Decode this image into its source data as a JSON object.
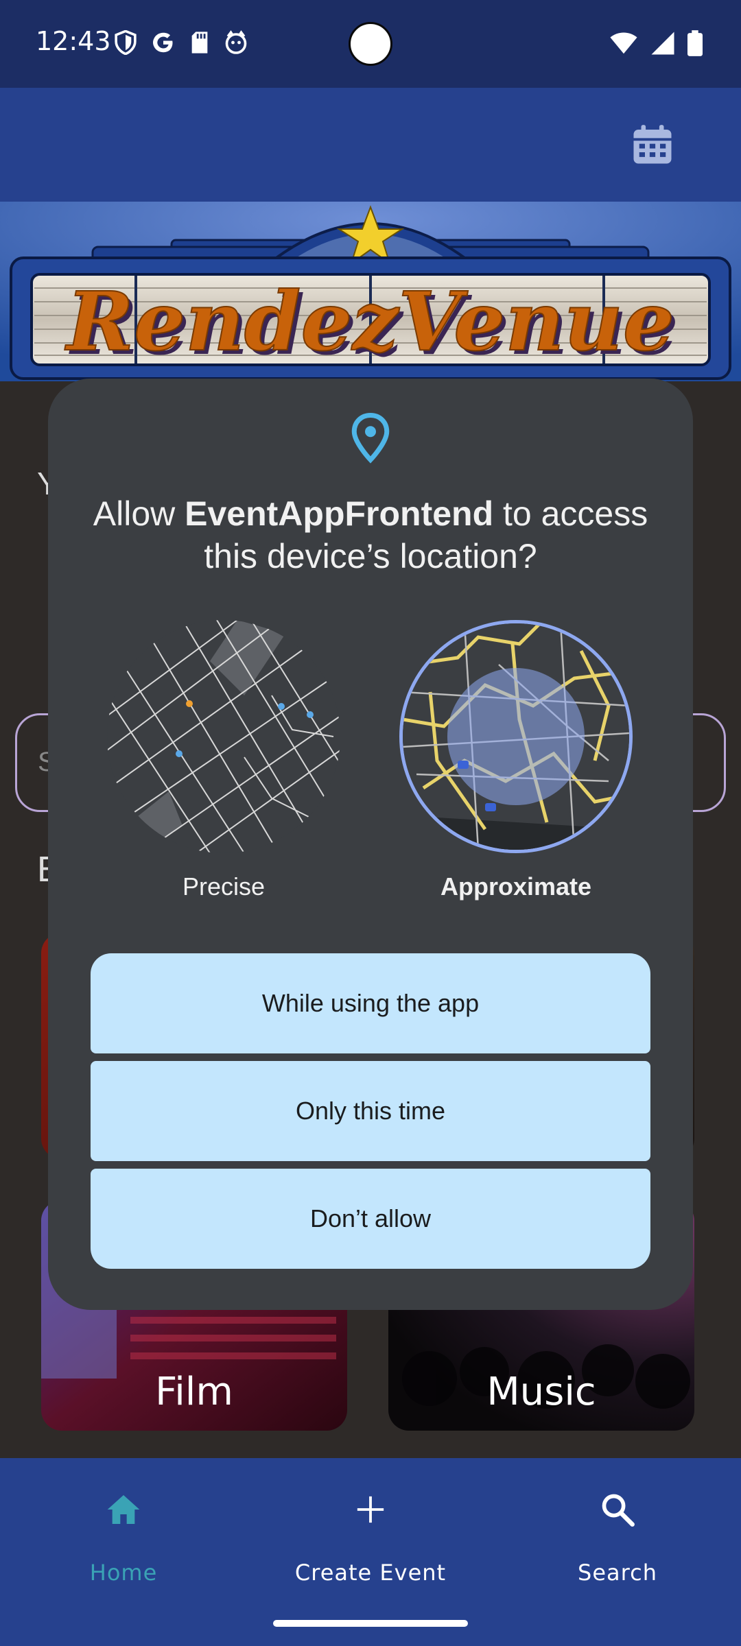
{
  "status_bar": {
    "time": "12:43"
  },
  "app": {
    "logo_text": "RendezVenue"
  },
  "background": {
    "greeting_partial": "Y",
    "search_placeholder_partial": "S",
    "section_partial": "E",
    "cards": [
      {
        "label": "Film"
      },
      {
        "label": "Music"
      }
    ]
  },
  "dialog": {
    "title_prefix": "Allow ",
    "app_name": "EventAppFrontend",
    "title_suffix": " to access this device’s location?",
    "options": [
      {
        "label": "Precise",
        "selected": false
      },
      {
        "label": "Approximate",
        "selected": true
      }
    ],
    "buttons": [
      {
        "label": "While using the app"
      },
      {
        "label": "Only this time"
      },
      {
        "label": "Don’t allow"
      }
    ]
  },
  "bottom_nav": {
    "items": [
      {
        "label": "Home",
        "icon": "home-icon",
        "active": true
      },
      {
        "label": "Create Event",
        "icon": "plus-icon",
        "active": false
      },
      {
        "label": "Search",
        "icon": "search-icon",
        "active": false
      }
    ]
  },
  "colors": {
    "status_bar": "#1c2d64",
    "app_bar": "#26418e",
    "dialog_bg": "#3b3e42",
    "button_bg": "#c3e6fd",
    "nav_active": "#3aa3b5",
    "logo_text": "#c8620a"
  }
}
